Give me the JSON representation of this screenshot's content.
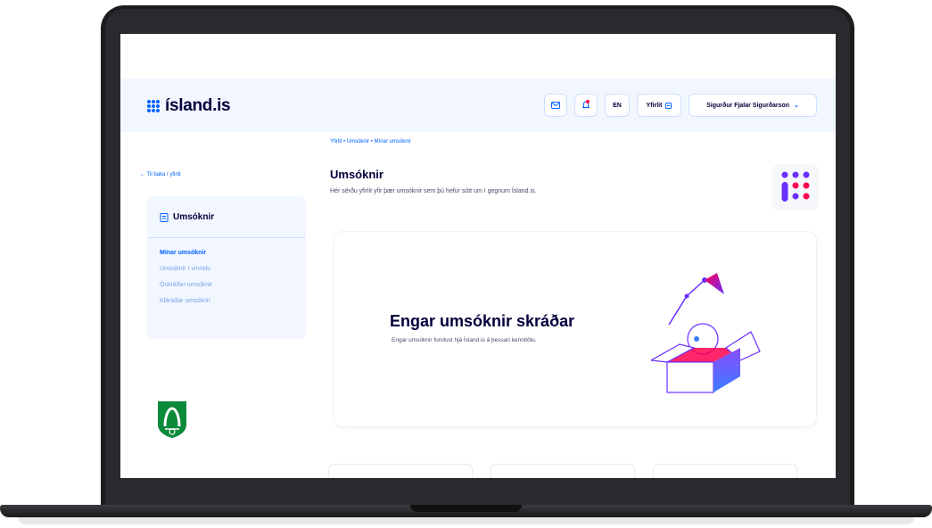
{
  "header": {
    "logo": "ísland.is",
    "lang": "EN",
    "overview": "Yfirlit",
    "user": "Sigurður Fjalar Sigurðarson"
  },
  "sidebar": {
    "back": "← Til baka í yfirlit",
    "title": "Umsóknir",
    "items": [
      {
        "label": "Mínar umsóknir"
      },
      {
        "label": "Umsóknir í vinnslu"
      },
      {
        "label": "Óskráðar umsóknir"
      },
      {
        "label": "Kláraðar umsóknir"
      }
    ]
  },
  "breadcrumb": "Yfirlit  •  Umsóknir  •  Mínar umsóknir",
  "main": {
    "title": "Umsóknir",
    "description": "Hér sérðu yfirlit yfir þær umsóknir sem þú hefur sótt um í gegnum Ísland.is.",
    "empty_title": "Engar umsóknir skráðar",
    "empty_description": "Engar umsóknir fundust hjá Ísland.is á þessari kennitölu."
  },
  "colors": {
    "primary": "#0061ff",
    "dark": "#00003c",
    "header_bg": "#f2f7ff",
    "accent_pink": "#ff0050",
    "accent_purple": "#6a2eff"
  },
  "icons": [
    "grid-logo-icon",
    "mail-icon",
    "notification-icon",
    "menu-icon",
    "chevron-down-icon",
    "document-icon",
    "crest-icon"
  ]
}
